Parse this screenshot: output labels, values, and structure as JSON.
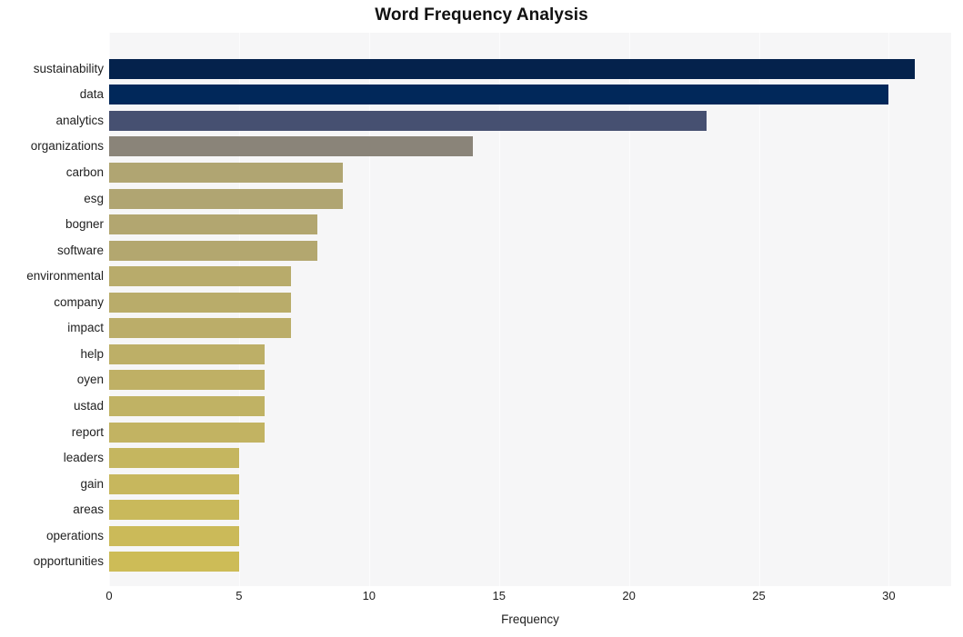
{
  "chart_data": {
    "type": "bar",
    "orientation": "horizontal",
    "title": "Word Frequency Analysis",
    "xlabel": "Frequency",
    "ylabel": "",
    "xlim": [
      0,
      32.4
    ],
    "xticks": [
      0,
      5,
      10,
      15,
      20,
      25,
      30
    ],
    "xtick_labels": [
      "0",
      "5",
      "10",
      "15",
      "20",
      "25",
      "30"
    ],
    "grid": "vertical-only",
    "legend": "none",
    "plot_background": "#f6f6f7",
    "figure_background": "#ffffff",
    "categories": [
      "sustainability",
      "data",
      "analytics",
      "organizations",
      "carbon",
      "esg",
      "bogner",
      "software",
      "environmental",
      "company",
      "impact",
      "help",
      "oyen",
      "ustad",
      "report",
      "leaders",
      "gain",
      "areas",
      "operations",
      "opportunities"
    ],
    "values": [
      31,
      30,
      23,
      14,
      9,
      9,
      8,
      8,
      7,
      7,
      7,
      6,
      6,
      6,
      6,
      5,
      5,
      5,
      5,
      5
    ],
    "bar_colors": [
      "#04224c",
      "#01285a",
      "#465071",
      "#8a8479",
      "#b0a572",
      "#b0a572",
      "#b2a670",
      "#b3a76f",
      "#b8ab6b",
      "#b9ac6a",
      "#bbad69",
      "#bdaf67",
      "#bfb065",
      "#c0b264",
      "#c2b362",
      "#c5b65f",
      "#c7b75d",
      "#c9b95b",
      "#cbba59",
      "#cdbc57"
    ]
  }
}
